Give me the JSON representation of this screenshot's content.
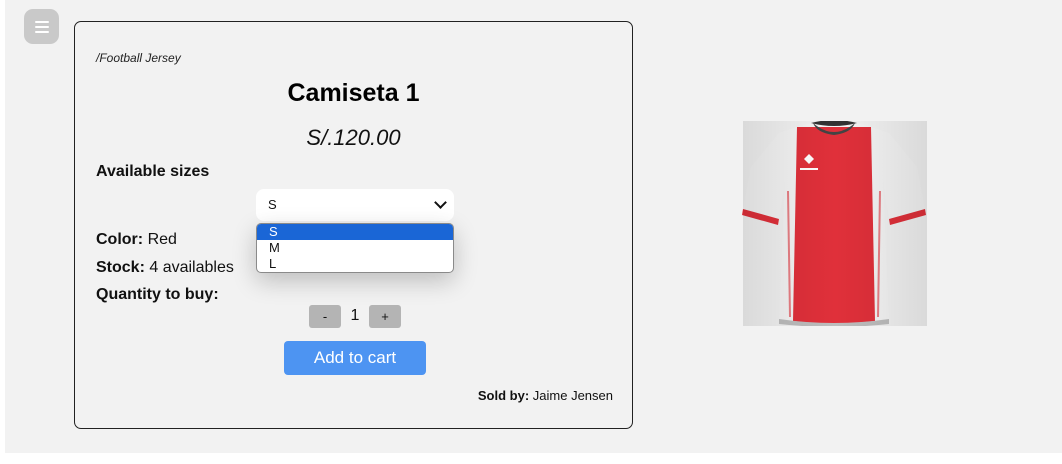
{
  "menu": {
    "icon": "hamburger-menu-icon"
  },
  "product": {
    "breadcrumb": "/Football Jersey",
    "title": "Camiseta 1",
    "price": "S/.120.00",
    "sizes_label": "Available sizes",
    "size_select": {
      "selected": "S",
      "options": [
        "S",
        "M",
        "L"
      ]
    },
    "color_label": "Color:",
    "color_value": "Red",
    "stock_label": "Stock:",
    "stock_value": "4 availables",
    "quantity_label": "Quantity to buy:",
    "quantity": {
      "minus_label": "-",
      "value": "1",
      "plus_label": "+"
    },
    "add_to_cart_label": "Add to cart",
    "sold_by_label": "Sold by:",
    "seller": "Jaime Jensen",
    "image": {
      "icon": "jersey-image",
      "primary_color": "#e0303a",
      "secondary_color": "#f4f4f4"
    }
  },
  "colors": {
    "accent_button": "#4d94f2",
    "dropdown_selected": "#1a66d6",
    "page_background": "#f2f2f2"
  }
}
